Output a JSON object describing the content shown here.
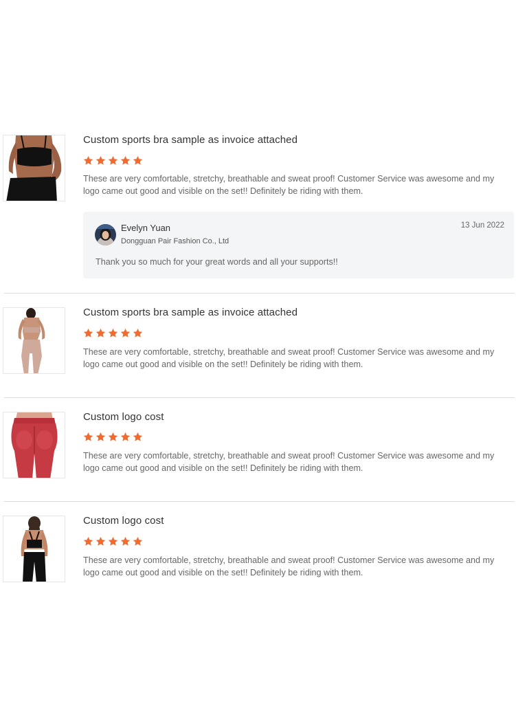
{
  "colors": {
    "star": "#f26a2e",
    "text_muted": "#666666",
    "divider": "#dcdcdc",
    "reply_bg": "#f4f5f7"
  },
  "reviews": [
    {
      "title": "Custom sports bra sample as invoice attached",
      "rating": 5,
      "text": "These are very comfortable, stretchy, breathable and sweat proof! Customer Service was awesome and my logo came out good and visible on the set!! Definitely be riding with them.",
      "image": "black-sports-bra-set-photo",
      "reply": {
        "name": "Evelyn Yuan",
        "company": "Dongguan Pair Fashion Co., Ltd",
        "date": "13 Jun 2022",
        "text": "Thank you so much for your great words and all your supports!!",
        "avatar": "supplier-avatar"
      }
    },
    {
      "title": "Custom sports bra sample as invoice attached",
      "rating": 5,
      "text": "These are very comfortable, stretchy, breathable and sweat proof! Customer Service was awesome and my logo came out good and visible on the set!! Definitely be riding with them.",
      "image": "beige-sports-bra-set-photo"
    },
    {
      "title": "Custom logo cost",
      "rating": 5,
      "text": "These are very comfortable, stretchy, breathable and sweat proof! Customer Service was awesome and my logo came out good and visible on the set!! Definitely be riding with them.",
      "image": "red-leggings-photo"
    },
    {
      "title": "Custom logo cost",
      "rating": 5,
      "text": "These are very comfortable, stretchy, breathable and sweat proof! Customer Service was awesome and my logo came out good and visible on the set!! Definitely be riding with them.",
      "image": "black-back-view-set-photo"
    }
  ]
}
